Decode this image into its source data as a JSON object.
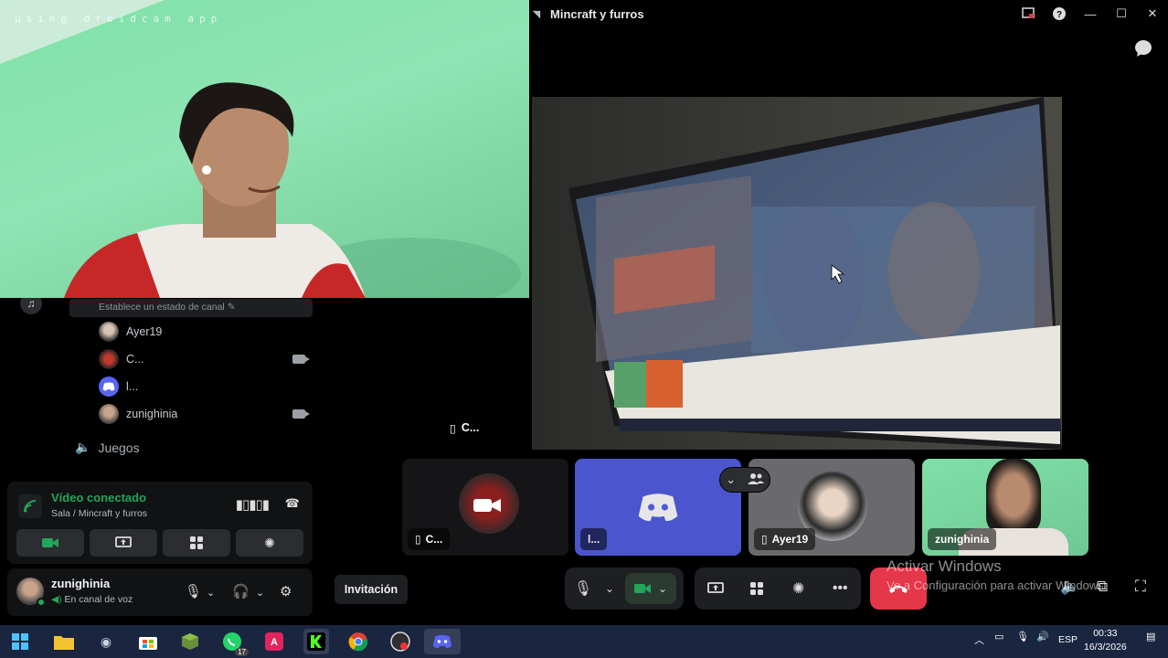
{
  "window": {
    "channel_title": "Mincraft y furros",
    "controls": [
      "inbox-icon",
      "help-icon",
      "minimize-icon",
      "maximize-icon",
      "close-icon"
    ]
  },
  "webcam_overlay": {
    "watermark": "using droidcam app"
  },
  "sidebar": {
    "status_placeholder": "Establece un estado de canal",
    "voice_members": [
      {
        "name": "Ayer19",
        "camera": false
      },
      {
        "name": "C...",
        "camera": true
      },
      {
        "name": "l...",
        "camera": false
      },
      {
        "name": "zunighinia",
        "camera": true
      }
    ],
    "other_channel": "Juegos"
  },
  "voice_panel": {
    "title": "Vídeo conectado",
    "subtitle": "Sala / Mincraft y furros"
  },
  "user": {
    "name": "zunighinia",
    "status": "En canal de voz"
  },
  "stage": {
    "label": "C..."
  },
  "tiles": [
    {
      "label": "C..."
    },
    {
      "label": "l..."
    },
    {
      "label": "Ayer19"
    },
    {
      "label": "zunighinia"
    }
  ],
  "controls": {
    "invite_label": "Invitación"
  },
  "watermark": {
    "line1": "Activar Windows",
    "line2": "Ve a Configuración para activar Windows."
  },
  "taskbar": {
    "whatsapp_badge": "17",
    "lang": "ESP",
    "time": "00:33",
    "date": "16/3/2026"
  },
  "colors": {
    "accent_green": "#23a55a",
    "hangup_red": "#e5374a",
    "panel_bg": "#111214",
    "taskbar_bg": "#1a2540"
  }
}
